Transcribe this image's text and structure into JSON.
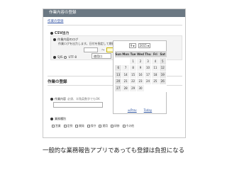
{
  "title_bar": "作業内容の登録",
  "sub_link": "作業の登録",
  "csv": {
    "title": "CSV出力",
    "option_label": "作業内容のログ",
    "description": "作業ログを出力します。日付を指定して期間ごとの履歴を出力できます。",
    "tilde": "〜",
    "encodings": [
      "SJIS",
      "UTF-8"
    ],
    "selected_encoding": "SJIS",
    "encoding_select": "使用口"
  },
  "task_section": {
    "heading": "作業の登録",
    "task_label": "作業内容",
    "task_note": "必須、半角英数字でもOK",
    "group_label": "業務種別",
    "checkboxes": [
      "営業",
      "定例",
      "開発",
      "保守",
      "運用",
      "研修",
      "その他"
    ]
  },
  "calendar": {
    "month": "9",
    "year": "2015",
    "weekdays": [
      "Sun",
      "Mon",
      "Tue",
      "Wed",
      "Thu",
      "Fri",
      "Sat"
    ],
    "weeks": [
      [
        "",
        "",
        "1",
        "2",
        "3",
        "4",
        "5"
      ],
      [
        "6",
        "7",
        "8",
        "9",
        "10",
        "11",
        "12"
      ],
      [
        "13",
        "14",
        "15",
        "16",
        "17",
        "18",
        "19"
      ],
      [
        "20",
        "21",
        "22",
        "23",
        "24",
        "25",
        "26"
      ],
      [
        "27",
        "28",
        "29",
        "30",
        "",
        "",
        ""
      ]
    ],
    "prev_label": "≪Prev",
    "today_label": "Today"
  },
  "caption": "一般的な業務報告アプリであっても登録は負担になる"
}
